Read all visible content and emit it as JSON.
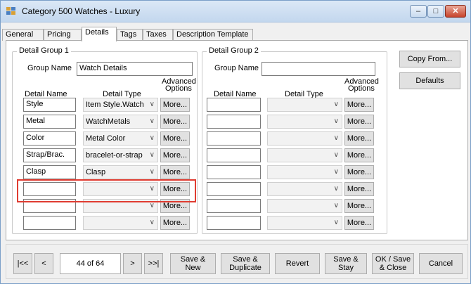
{
  "window": {
    "title": "Category 500 Watches  - Luxury"
  },
  "titlebar": {
    "minimize": "–",
    "maximize": "□",
    "close": "✕"
  },
  "tabs": [
    "General",
    "Pricing",
    "Details",
    "Tags",
    "Taxes",
    "Description Template"
  ],
  "active_tab": "Details",
  "group1": {
    "title": "Detail Group 1",
    "group_name_label": "Group Name",
    "group_name_value": "Watch Details",
    "col_detail_name": "Detail Name",
    "col_detail_type": "Detail Type",
    "col_advanced_1": "Advanced",
    "col_advanced_2": "Options",
    "rows": [
      {
        "name": "Style",
        "type": "Item Style.Watch",
        "more": "More..."
      },
      {
        "name": "Metal",
        "type": "WatchMetals",
        "more": "More..."
      },
      {
        "name": "Color",
        "type": "Metal Color",
        "more": "More..."
      },
      {
        "name": "Strap/Brac.",
        "type": "bracelet-or-strap",
        "more": "More..."
      },
      {
        "name": "Clasp",
        "type": "Clasp",
        "more": "More..."
      },
      {
        "name": "",
        "type": "",
        "more": "More..."
      },
      {
        "name": "",
        "type": "",
        "more": "More..."
      },
      {
        "name": "",
        "type": "",
        "more": "More..."
      }
    ]
  },
  "group2": {
    "title": "Detail Group 2",
    "group_name_label": "Group Name",
    "group_name_value": "",
    "col_detail_name": "Detail Name",
    "col_detail_type": "Detail Type",
    "col_advanced_1": "Advanced",
    "col_advanced_2": "Options",
    "rows": [
      {
        "name": "",
        "type": "",
        "more": "More..."
      },
      {
        "name": "",
        "type": "",
        "more": "More..."
      },
      {
        "name": "",
        "type": "",
        "more": "More..."
      },
      {
        "name": "",
        "type": "",
        "more": "More..."
      },
      {
        "name": "",
        "type": "",
        "more": "More..."
      },
      {
        "name": "",
        "type": "",
        "more": "More..."
      },
      {
        "name": "",
        "type": "",
        "more": "More..."
      },
      {
        "name": "",
        "type": "",
        "more": "More..."
      }
    ]
  },
  "side_buttons": {
    "copy_from": "Copy From...",
    "defaults": "Defaults"
  },
  "nav": {
    "first": "|<<",
    "prev": "<",
    "record": "44 of 64",
    "next": ">",
    "last": ">>|",
    "save_new_1": "Save &",
    "save_new_2": "New",
    "save_dup_1": "Save &",
    "save_dup_2": "Duplicate",
    "revert": "Revert",
    "save_stay_1": "Save &",
    "save_stay_2": "Stay",
    "ok_save_1": "OK / Save",
    "ok_save_2": "& Close",
    "cancel": "Cancel"
  },
  "colors": {
    "highlight": "#e03c31",
    "titlebar": "#c9dcf1"
  }
}
